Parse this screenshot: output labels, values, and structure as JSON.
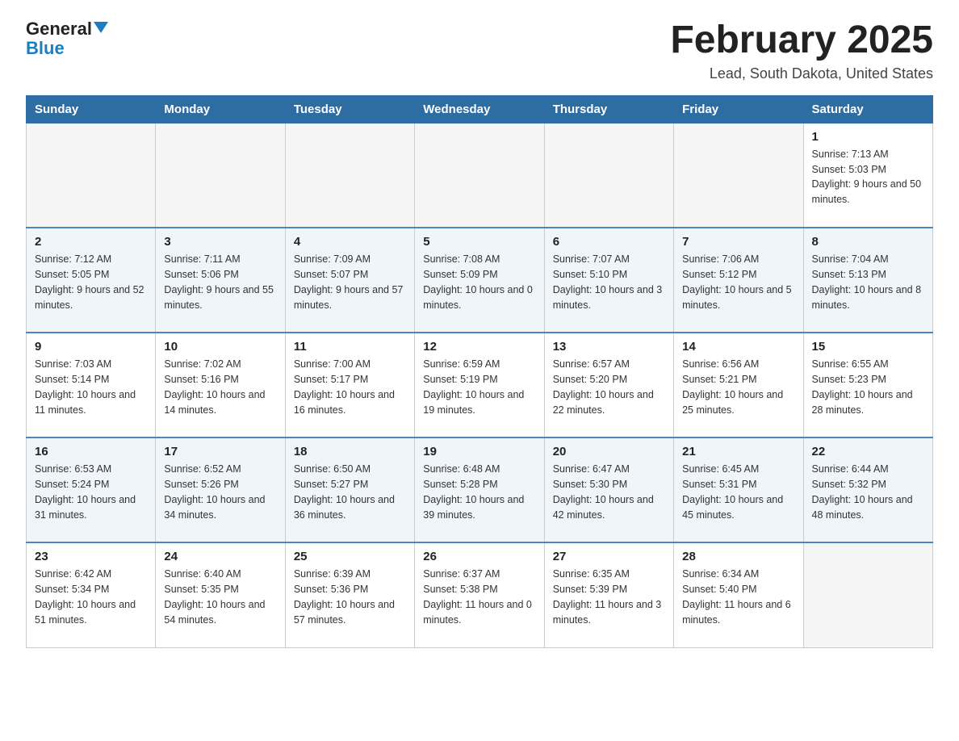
{
  "header": {
    "logo": {
      "line1": "General",
      "line2": "Blue"
    },
    "title": "February 2025",
    "location": "Lead, South Dakota, United States"
  },
  "days_of_week": [
    "Sunday",
    "Monday",
    "Tuesday",
    "Wednesday",
    "Thursday",
    "Friday",
    "Saturday"
  ],
  "weeks": [
    [
      {
        "day": "",
        "info": ""
      },
      {
        "day": "",
        "info": ""
      },
      {
        "day": "",
        "info": ""
      },
      {
        "day": "",
        "info": ""
      },
      {
        "day": "",
        "info": ""
      },
      {
        "day": "",
        "info": ""
      },
      {
        "day": "1",
        "info": "Sunrise: 7:13 AM\nSunset: 5:03 PM\nDaylight: 9 hours and 50 minutes."
      }
    ],
    [
      {
        "day": "2",
        "info": "Sunrise: 7:12 AM\nSunset: 5:05 PM\nDaylight: 9 hours and 52 minutes."
      },
      {
        "day": "3",
        "info": "Sunrise: 7:11 AM\nSunset: 5:06 PM\nDaylight: 9 hours and 55 minutes."
      },
      {
        "day": "4",
        "info": "Sunrise: 7:09 AM\nSunset: 5:07 PM\nDaylight: 9 hours and 57 minutes."
      },
      {
        "day": "5",
        "info": "Sunrise: 7:08 AM\nSunset: 5:09 PM\nDaylight: 10 hours and 0 minutes."
      },
      {
        "day": "6",
        "info": "Sunrise: 7:07 AM\nSunset: 5:10 PM\nDaylight: 10 hours and 3 minutes."
      },
      {
        "day": "7",
        "info": "Sunrise: 7:06 AM\nSunset: 5:12 PM\nDaylight: 10 hours and 5 minutes."
      },
      {
        "day": "8",
        "info": "Sunrise: 7:04 AM\nSunset: 5:13 PM\nDaylight: 10 hours and 8 minutes."
      }
    ],
    [
      {
        "day": "9",
        "info": "Sunrise: 7:03 AM\nSunset: 5:14 PM\nDaylight: 10 hours and 11 minutes."
      },
      {
        "day": "10",
        "info": "Sunrise: 7:02 AM\nSunset: 5:16 PM\nDaylight: 10 hours and 14 minutes."
      },
      {
        "day": "11",
        "info": "Sunrise: 7:00 AM\nSunset: 5:17 PM\nDaylight: 10 hours and 16 minutes."
      },
      {
        "day": "12",
        "info": "Sunrise: 6:59 AM\nSunset: 5:19 PM\nDaylight: 10 hours and 19 minutes."
      },
      {
        "day": "13",
        "info": "Sunrise: 6:57 AM\nSunset: 5:20 PM\nDaylight: 10 hours and 22 minutes."
      },
      {
        "day": "14",
        "info": "Sunrise: 6:56 AM\nSunset: 5:21 PM\nDaylight: 10 hours and 25 minutes."
      },
      {
        "day": "15",
        "info": "Sunrise: 6:55 AM\nSunset: 5:23 PM\nDaylight: 10 hours and 28 minutes."
      }
    ],
    [
      {
        "day": "16",
        "info": "Sunrise: 6:53 AM\nSunset: 5:24 PM\nDaylight: 10 hours and 31 minutes."
      },
      {
        "day": "17",
        "info": "Sunrise: 6:52 AM\nSunset: 5:26 PM\nDaylight: 10 hours and 34 minutes."
      },
      {
        "day": "18",
        "info": "Sunrise: 6:50 AM\nSunset: 5:27 PM\nDaylight: 10 hours and 36 minutes."
      },
      {
        "day": "19",
        "info": "Sunrise: 6:48 AM\nSunset: 5:28 PM\nDaylight: 10 hours and 39 minutes."
      },
      {
        "day": "20",
        "info": "Sunrise: 6:47 AM\nSunset: 5:30 PM\nDaylight: 10 hours and 42 minutes."
      },
      {
        "day": "21",
        "info": "Sunrise: 6:45 AM\nSunset: 5:31 PM\nDaylight: 10 hours and 45 minutes."
      },
      {
        "day": "22",
        "info": "Sunrise: 6:44 AM\nSunset: 5:32 PM\nDaylight: 10 hours and 48 minutes."
      }
    ],
    [
      {
        "day": "23",
        "info": "Sunrise: 6:42 AM\nSunset: 5:34 PM\nDaylight: 10 hours and 51 minutes."
      },
      {
        "day": "24",
        "info": "Sunrise: 6:40 AM\nSunset: 5:35 PM\nDaylight: 10 hours and 54 minutes."
      },
      {
        "day": "25",
        "info": "Sunrise: 6:39 AM\nSunset: 5:36 PM\nDaylight: 10 hours and 57 minutes."
      },
      {
        "day": "26",
        "info": "Sunrise: 6:37 AM\nSunset: 5:38 PM\nDaylight: 11 hours and 0 minutes."
      },
      {
        "day": "27",
        "info": "Sunrise: 6:35 AM\nSunset: 5:39 PM\nDaylight: 11 hours and 3 minutes."
      },
      {
        "day": "28",
        "info": "Sunrise: 6:34 AM\nSunset: 5:40 PM\nDaylight: 11 hours and 6 minutes."
      },
      {
        "day": "",
        "info": ""
      }
    ]
  ]
}
